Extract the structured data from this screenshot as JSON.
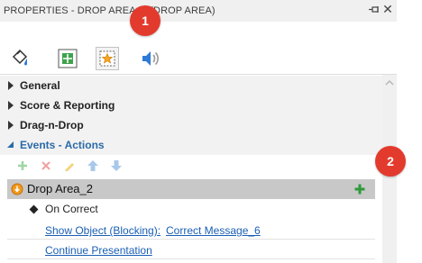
{
  "panel": {
    "title": "PROPERTIES - DROP AREA_2 (DROP AREA)",
    "toolbar": [
      "fill-icon",
      "position-size-icon",
      "drop-area-properties-icon",
      "audio-icon"
    ]
  },
  "sections": [
    {
      "label": "General",
      "expanded": false
    },
    {
      "label": "Score & Reporting",
      "expanded": false
    },
    {
      "label": "Drag-n-Drop",
      "expanded": false
    },
    {
      "label": "Events - Actions",
      "expanded": true
    }
  ],
  "actions_toolbar": [
    "add-action-icon",
    "delete-action-icon",
    "edit-action-icon",
    "move-up-icon",
    "move-down-icon"
  ],
  "drop_area": {
    "label": "Drop Area_2"
  },
  "event": {
    "label": "On Correct"
  },
  "actions": [
    {
      "action": "Show Object (Blocking):",
      "target": "Correct Message_6"
    },
    {
      "action": "Continue Presentation",
      "target": ""
    }
  ],
  "callouts": [
    "1",
    "2"
  ],
  "colors": {
    "callout": "#e23b2e",
    "link": "#1a5fb4",
    "section_bg": "#f2f2f2",
    "selected_row": "#c8c8c8"
  }
}
